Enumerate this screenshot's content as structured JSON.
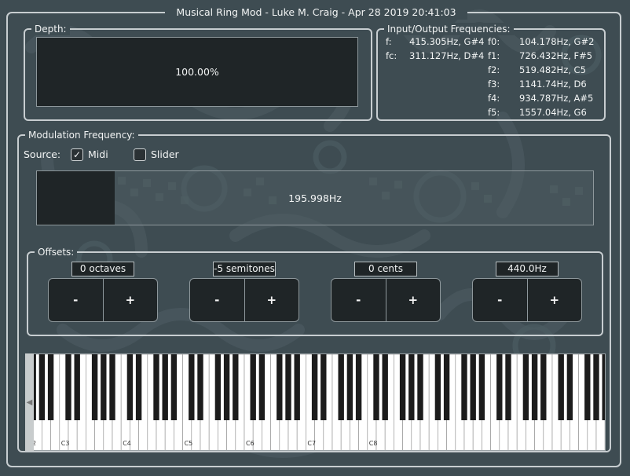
{
  "title": "Musical Ring Mod - Luke M. Craig - Apr 28 2019 20:41:03",
  "depth": {
    "label": "Depth:",
    "value_text": "100.00%"
  },
  "io": {
    "label": "Input/Output Frequencies:",
    "f_key": "f:",
    "f_val": "415.305Hz, G#4",
    "fc_key": "fc:",
    "fc_val": "311.127Hz, D#4",
    "outputs": [
      {
        "key": "f0:",
        "val": "104.178Hz, G#2"
      },
      {
        "key": "f1:",
        "val": "726.432Hz, F#5"
      },
      {
        "key": "f2:",
        "val": "519.482Hz, C5"
      },
      {
        "key": "f3:",
        "val": "1141.74Hz, D6"
      },
      {
        "key": "f4:",
        "val": "934.787Hz, A#5"
      },
      {
        "key": "f5:",
        "val": "1557.04Hz, G6"
      }
    ]
  },
  "modulation": {
    "label": "Modulation Frequency:",
    "source_label": "Source:",
    "midi_label": "Midi",
    "midi_checked": true,
    "check_glyph": "✓",
    "slider_label": "Slider",
    "slider_checked": false,
    "freq_text": "195.998Hz",
    "slider_fraction": 0.14
  },
  "offsets": {
    "label": "Offsets:",
    "octaves": "0 octaves",
    "semitones": "-5 semitones",
    "cents": "0 cents",
    "reference": "440.0Hz",
    "minus": "-",
    "plus": "+"
  },
  "keyboard": {
    "octave_labels": [
      "2",
      "C3",
      "C4",
      "C5",
      "C6",
      "C7",
      "C8"
    ],
    "scroll_glyph": "◀"
  },
  "colors": {
    "background": "#3e4c52",
    "panel": "#1f2527",
    "border": "#c7cdd0"
  }
}
